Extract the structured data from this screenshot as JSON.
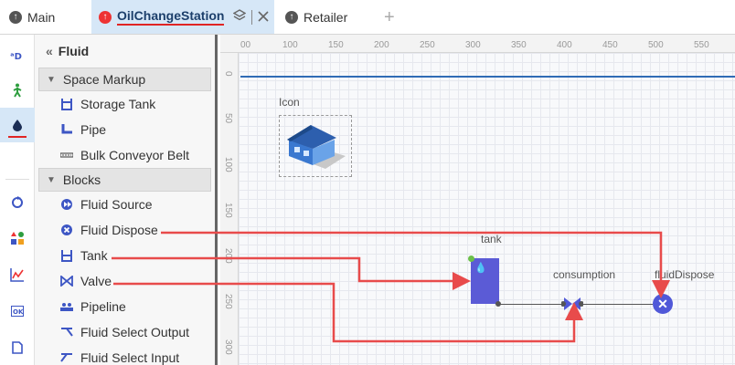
{
  "tabs": [
    {
      "label": "Main",
      "active": false
    },
    {
      "label": "OilChangeStation",
      "active": true
    },
    {
      "label": "Retailer",
      "active": false
    }
  ],
  "add_tab_glyph": "+",
  "rail_icons": [
    "agent-icon",
    "pedestrian-icon",
    "fluid-icon",
    "process-icon",
    "presentation-icon",
    "analysis-icon",
    "controls-icon",
    "document-icon"
  ],
  "palette": {
    "title": "Fluid",
    "sections": [
      {
        "label": "Space Markup",
        "items": [
          "Storage Tank",
          "Pipe",
          "Bulk Conveyor Belt"
        ]
      },
      {
        "label": "Blocks",
        "items": [
          "Fluid Source",
          "Fluid Dispose",
          "Tank",
          "Valve",
          "Pipeline",
          "Fluid Select Output",
          "Fluid Select Input"
        ]
      }
    ]
  },
  "ruler": {
    "x_ticks": [
      "00",
      "100",
      "150",
      "200",
      "250",
      "300",
      "350",
      "400",
      "450",
      "500",
      "550"
    ],
    "y_ticks": [
      "0",
      "50",
      "100",
      "150",
      "200",
      "250",
      "300"
    ]
  },
  "canvas": {
    "icon_label": "Icon",
    "tank_label": "tank",
    "valve_label": "consumption",
    "dispose_label": "fluidDispose"
  },
  "colors": {
    "accent": "#e02424",
    "block_blue": "#5b5bd6",
    "arrow_red": "#e84b4b",
    "axis_line": "#2f6bb5"
  }
}
